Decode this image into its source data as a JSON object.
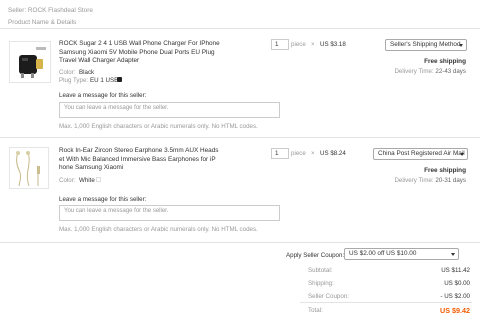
{
  "seller": {
    "label": "Seller:",
    "name": "ROCK Flashdeal Store"
  },
  "header": {
    "product_details": "Product Name & Details"
  },
  "items": [
    {
      "title": "ROCK Sugar 2 4 1 USB Wall Phone Charger For IPhone Samsung Xiaomi 5V Mobile Phone Dual Ports EU Plug Travel Wall Charger Adapter",
      "attr1_label": "Color:",
      "attr1_value": "Black",
      "attr2_label": "Plug Type:",
      "attr2_value": "EU 1 USB",
      "quantity": "1",
      "unit": "piece",
      "times": "×",
      "price": "US $3.18",
      "shipping_method": "Seller's Shipping Method",
      "shipping_cost": "Free shipping",
      "delivery_label": "Delivery Time:",
      "delivery_value": "22-43 days",
      "message_label": "Leave a message for this seller:",
      "message_placeholder": "You can leave a message for the seller.",
      "message_hint": "Max. 1,000 English characters or Arabic numerals only. No HTML codes."
    },
    {
      "title": "Rock In-Ear Zircon Stereo Earphone 3.5mm AUX Headset With Mic Balanced Immersive Bass Earphones for iPhone Samsung Xiaomi",
      "title_line1": "Rock In-Ear Zircon Stereo Earphone 3.5mm AUX Heads",
      "title_line2": "et With Mic Balanced Immersive Bass Earphones for iP",
      "title_line3": "hone Samsung Xiaomi",
      "attr1_label": "Color:",
      "attr1_value": "White",
      "quantity": "1",
      "unit": "piece",
      "times": "×",
      "price": "US $8.24",
      "shipping_method": "China Post Registered Air Mail",
      "shipping_cost": "Free shipping",
      "delivery_label": "Delivery Time:",
      "delivery_value": "20-31 days",
      "message_label": "Leave a message for this seller:",
      "message_placeholder": "You can leave a message for the seller.",
      "message_hint": "Max. 1,000 English characters or Arabic numerals only. No HTML codes."
    }
  ],
  "coupon": {
    "label": "Apply Seller Coupon:",
    "selected": "US $2.00 off US $10.00"
  },
  "summary": {
    "subtotal_label": "Subtotal:",
    "subtotal_value": "US $11.42",
    "shipping_label": "Shipping:",
    "shipping_value": "US $0.00",
    "coupon_label": "Seller Coupon:",
    "coupon_value": "- US $2.00",
    "total_label": "Total:",
    "total_value": "US $9.42"
  },
  "colors": {
    "total": "#f25a00",
    "border": "#e3e3e3",
    "muted": "#999999"
  }
}
